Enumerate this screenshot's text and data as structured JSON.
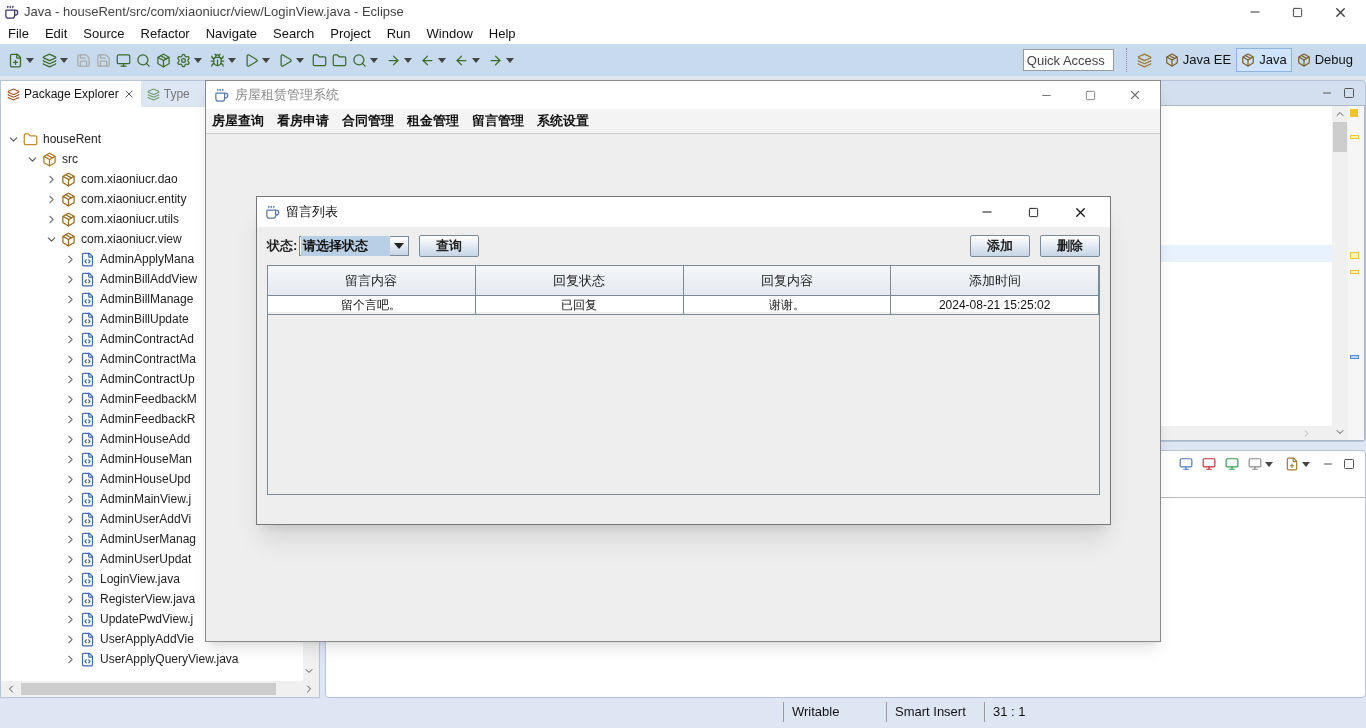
{
  "window": {
    "title": "Java - houseRent/src/com/xiaoniucr/view/LoginView.java - Eclipse"
  },
  "menu": [
    "File",
    "Edit",
    "Source",
    "Refactor",
    "Navigate",
    "Search",
    "Project",
    "Run",
    "Window",
    "Help"
  ],
  "toolbar": {
    "quick_access": {
      "placeholder": "Quick Access"
    },
    "perspectives": [
      {
        "label": "Java EE",
        "selected": false
      },
      {
        "label": "Java",
        "selected": true
      },
      {
        "label": "Debug",
        "selected": false
      }
    ]
  },
  "package_explorer": {
    "tabs": [
      {
        "label": "Package Explorer",
        "selected": true
      },
      {
        "label": "Type",
        "selected": false
      }
    ],
    "tree": [
      {
        "label": "houseRent",
        "kind": "project",
        "expanded": true,
        "children": [
          {
            "label": "src",
            "kind": "folder",
            "expanded": true,
            "children": [
              {
                "label": "com.xiaoniucr.dao",
                "kind": "package",
                "expanded": false
              },
              {
                "label": "com.xiaoniucr.entity",
                "kind": "package",
                "expanded": false
              },
              {
                "label": "com.xiaoniucr.utils",
                "kind": "package",
                "expanded": false
              },
              {
                "label": "com.xiaoniucr.view",
                "kind": "package",
                "expanded": true,
                "children": [
                  {
                    "label": "AdminApplyMana",
                    "kind": "file",
                    "expanded": false
                  },
                  {
                    "label": "AdminBillAddView",
                    "kind": "file",
                    "expanded": false
                  },
                  {
                    "label": "AdminBillManage",
                    "kind": "file",
                    "expanded": false
                  },
                  {
                    "label": "AdminBillUpdate",
                    "kind": "file",
                    "expanded": false
                  },
                  {
                    "label": "AdminContractAd",
                    "kind": "file",
                    "expanded": false
                  },
                  {
                    "label": "AdminContractMa",
                    "kind": "file",
                    "expanded": false
                  },
                  {
                    "label": "AdminContractUp",
                    "kind": "file",
                    "expanded": false
                  },
                  {
                    "label": "AdminFeedbackM",
                    "kind": "file",
                    "expanded": false
                  },
                  {
                    "label": "AdminFeedbackR",
                    "kind": "file",
                    "expanded": false
                  },
                  {
                    "label": "AdminHouseAdd",
                    "kind": "file",
                    "expanded": false
                  },
                  {
                    "label": "AdminHouseMan",
                    "kind": "file",
                    "expanded": false
                  },
                  {
                    "label": "AdminHouseUpd",
                    "kind": "file",
                    "expanded": false
                  },
                  {
                    "label": "AdminMainView.j",
                    "kind": "file",
                    "expanded": false
                  },
                  {
                    "label": "AdminUserAddVi",
                    "kind": "file",
                    "expanded": false
                  },
                  {
                    "label": "AdminUserManag",
                    "kind": "file",
                    "expanded": false
                  },
                  {
                    "label": "AdminUserUpdat",
                    "kind": "file",
                    "expanded": false
                  },
                  {
                    "label": "LoginView.java",
                    "kind": "file",
                    "expanded": false
                  },
                  {
                    "label": "RegisterView.java",
                    "kind": "file",
                    "expanded": false
                  },
                  {
                    "label": "UpdatePwdView.j",
                    "kind": "file",
                    "expanded": false
                  },
                  {
                    "label": "UserApplyAddVie",
                    "kind": "file",
                    "expanded": false
                  },
                  {
                    "label": "UserApplyQueryView.java",
                    "kind": "file",
                    "expanded": false
                  }
                ]
              }
            ]
          }
        ]
      }
    ]
  },
  "status_bar": [
    "Writable",
    "Smart Insert",
    "31 : 1"
  ],
  "app_window": {
    "title": "房屋租赁管理系统",
    "menu": [
      "房屋查询",
      "看房申请",
      "合同管理",
      "租金管理",
      "留言管理",
      "系统设置"
    ]
  },
  "dialog": {
    "title": "留言列表",
    "filter_label": "状态:",
    "status_select": {
      "value": "请选择状态"
    },
    "buttons": [
      "查询",
      "添加",
      "删除"
    ],
    "table": {
      "columns": [
        "留言内容",
        "回复状态",
        "回复内容",
        "添加时间"
      ],
      "rows": [
        [
          "留个言吧。",
          "已回复",
          "谢谢。",
          "2024-08-21 15:25:02"
        ]
      ]
    }
  }
}
